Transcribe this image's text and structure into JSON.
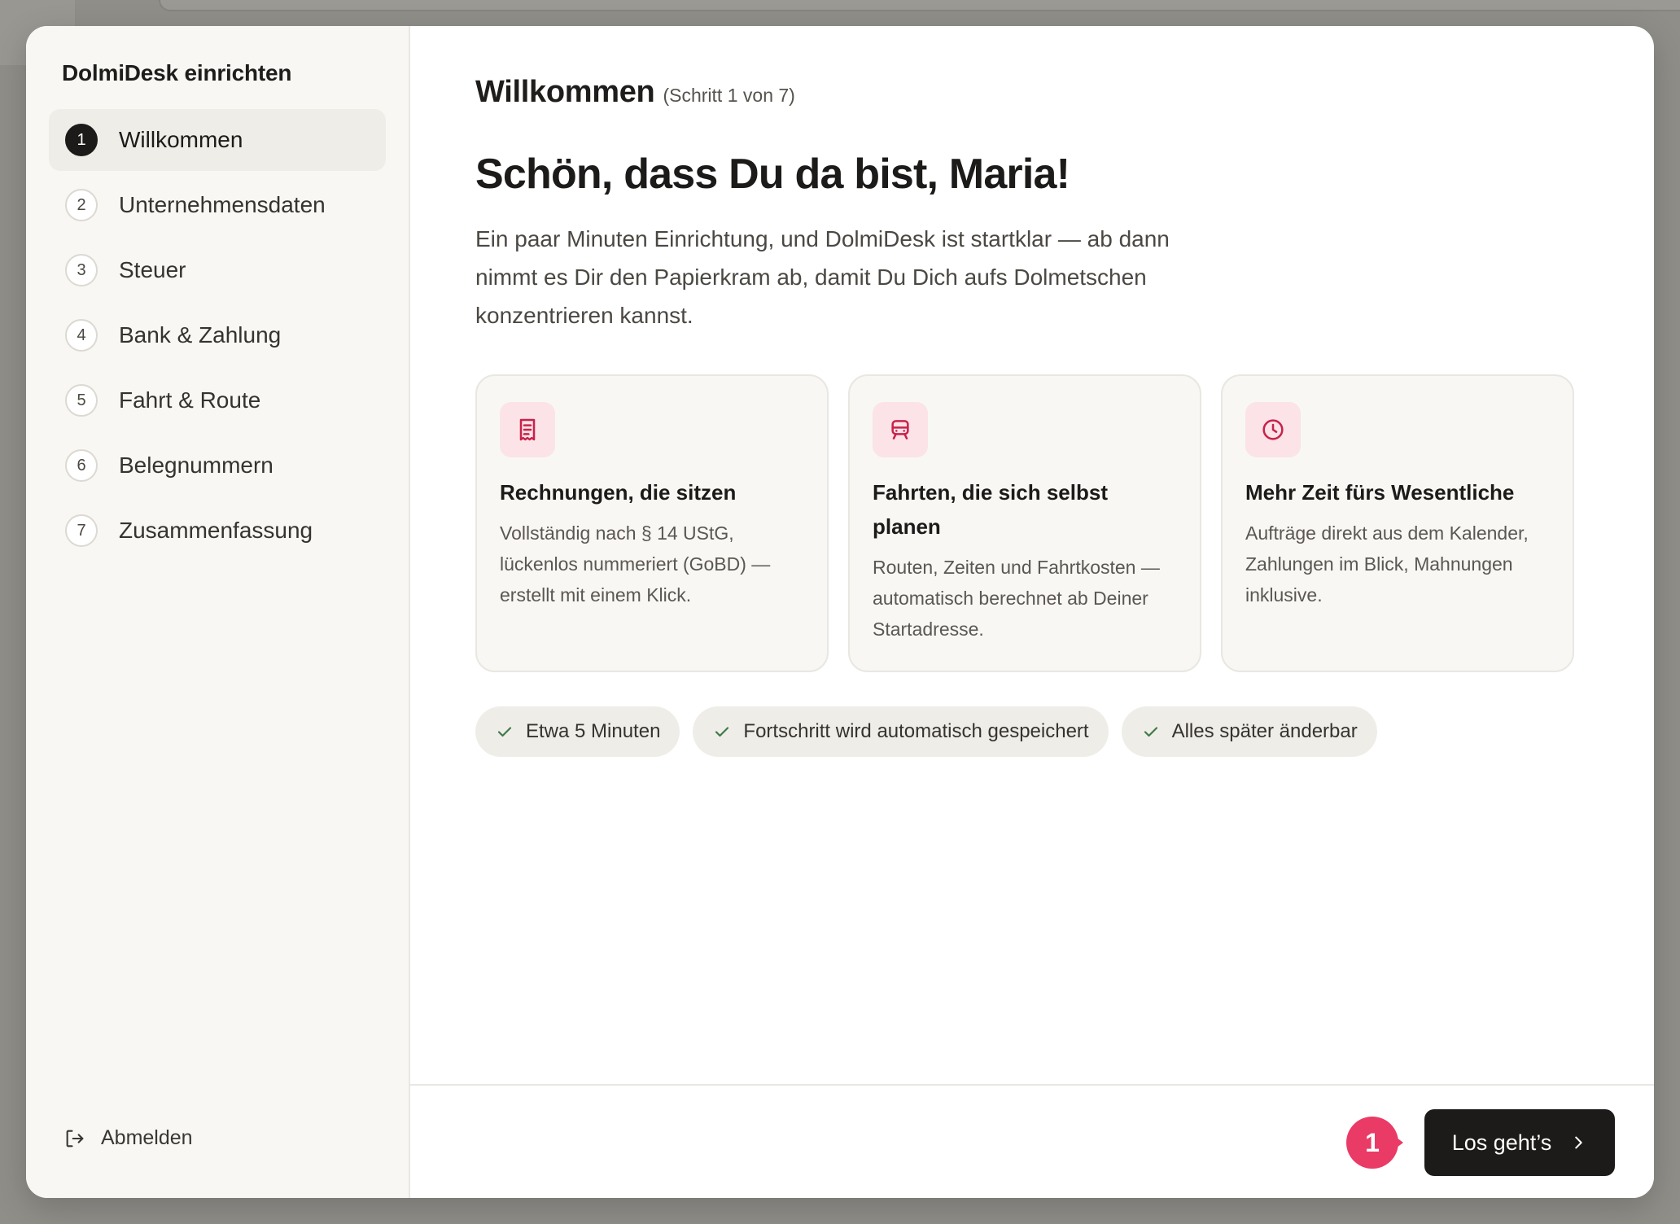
{
  "sidebar": {
    "title": "DolmiDesk einrichten",
    "steps": [
      {
        "num": "1",
        "label": "Willkommen"
      },
      {
        "num": "2",
        "label": "Unternehmensdaten"
      },
      {
        "num": "3",
        "label": "Steuer"
      },
      {
        "num": "4",
        "label": "Bank & Zahlung"
      },
      {
        "num": "5",
        "label": "Fahrt & Route"
      },
      {
        "num": "6",
        "label": "Belegnummern"
      },
      {
        "num": "7",
        "label": "Zusammenfassung"
      }
    ],
    "active_step": 1,
    "logout_label": "Abmelden"
  },
  "main": {
    "title": "Willkommen",
    "step_indicator": "(Schritt 1 von 7)",
    "hero": "Schön, dass Du da bist, Maria!",
    "intro": "Ein paar Minuten Einrichtung, und DolmiDesk ist startklar — ab dann nimmt es Dir den Papierkram ab, damit Du Dich aufs Dolmetschen konzentrieren kannst.",
    "cards": [
      {
        "icon": "receipt-icon",
        "title": "Rechnungen, die sitzen",
        "text": "Vollständig nach § 14 UStG, lückenlos nummeriert (GoBD) — erstellt mit einem Klick."
      },
      {
        "icon": "train-icon",
        "title": "Fahrten, die sich selbst planen",
        "text": "Routen, Zeiten und Fahrtkosten — automatisch berechnet ab Deiner Startadresse."
      },
      {
        "icon": "clock-icon",
        "title": "Mehr Zeit fürs Wesentliche",
        "text": "Aufträge direkt aus dem Kalender, Zahlungen im Blick, Mahnungen inklusive."
      }
    ],
    "chips": [
      "Etwa 5 Minuten",
      "Fortschritt wird automatisch gespeichert",
      "Alles später änderbar"
    ]
  },
  "footer": {
    "badge": "1",
    "primary_label": "Los geht’s"
  },
  "colors": {
    "accent": "#ea3a66",
    "icon_accent": "#c8224a",
    "icon_bg": "#fbe3e8",
    "check": "#3f7a4a",
    "dark": "#1d1b19"
  }
}
